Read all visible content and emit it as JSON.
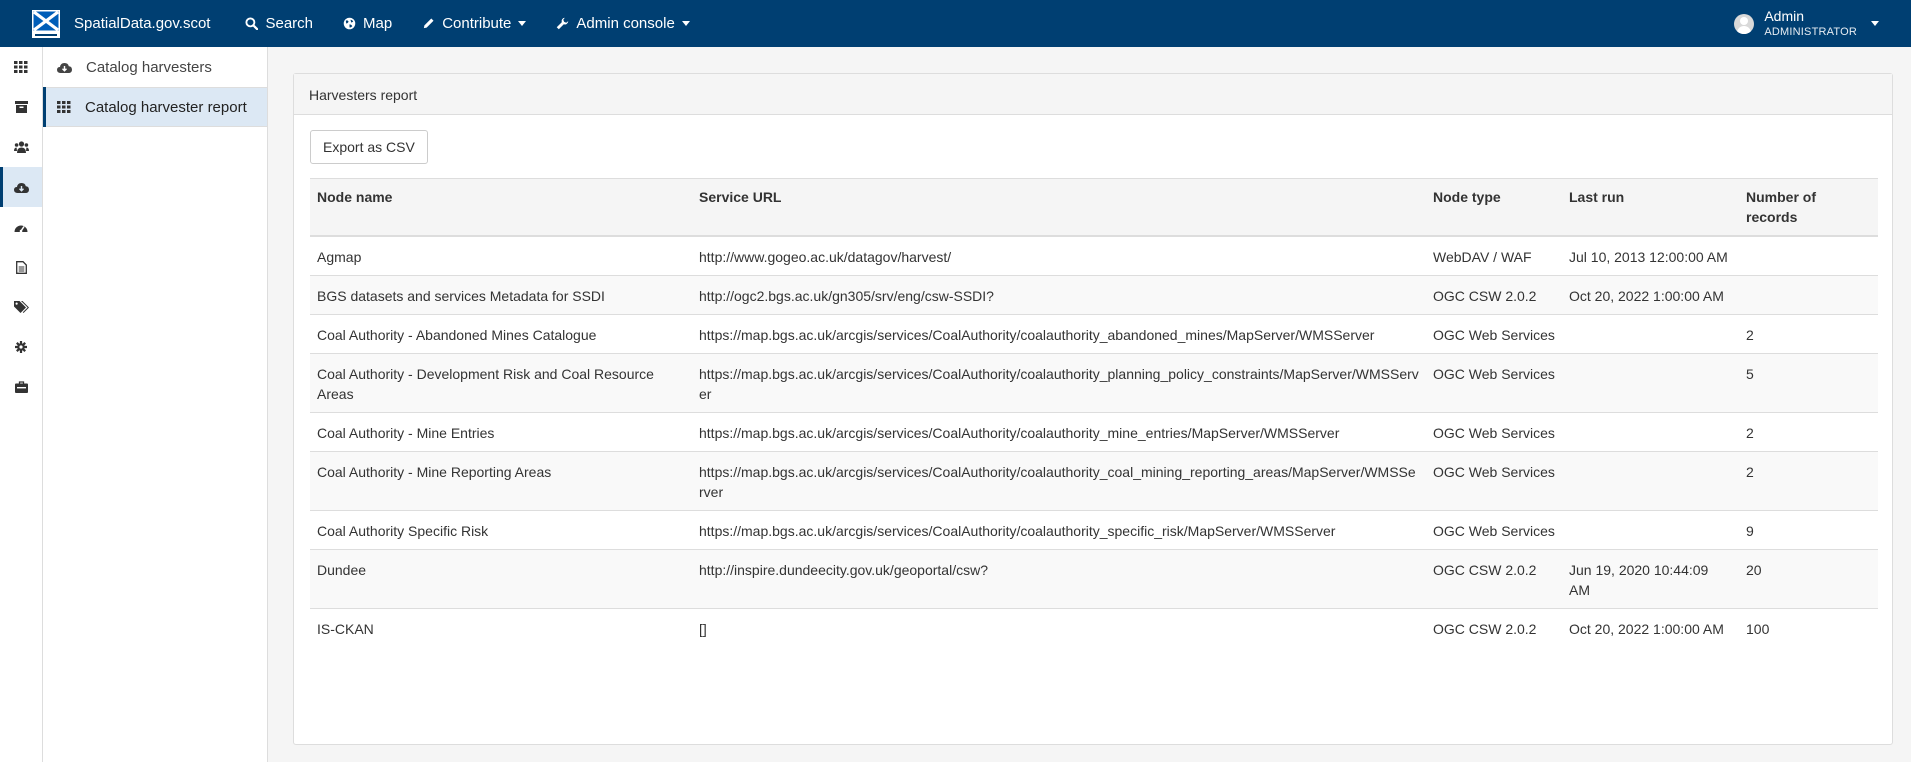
{
  "navbar": {
    "brand_name": "SpatialData.gov.scot",
    "items": [
      {
        "label": "Search",
        "icon": "search-icon"
      },
      {
        "label": "Map",
        "icon": "globe-icon"
      },
      {
        "label": "Contribute",
        "icon": "pencil-icon"
      },
      {
        "label": "Admin console",
        "icon": "wrench-icon"
      }
    ],
    "user": {
      "name": "Admin",
      "role": "ADMINISTRATOR"
    }
  },
  "rail": {
    "items": [
      "grid-icon",
      "archive-icon",
      "users-icon",
      "cloud-download-icon",
      "dashboard-icon",
      "file-icon",
      "tags-icon",
      "gear-icon",
      "toolbox-icon"
    ],
    "active_index": 3
  },
  "subnav": {
    "items": [
      {
        "label": "Catalog harvesters",
        "icon": "cloud-download-icon"
      },
      {
        "label": "Catalog harvester report",
        "icon": "grid-icon"
      }
    ],
    "active_index": 1
  },
  "panel": {
    "title": "Harvesters report",
    "export_label": "Export as CSV"
  },
  "table": {
    "headers": {
      "node_name": "Node name",
      "service_url": "Service URL",
      "node_type": "Node type",
      "last_run": "Last run",
      "num_records": "Number of records"
    },
    "rows": [
      {
        "node_name": "Agmap",
        "service_url": "http://www.gogeo.ac.uk/datagov/harvest/",
        "node_type": "WebDAV / WAF",
        "last_run": "Jul 10, 2013 12:00:00 AM",
        "num_records": ""
      },
      {
        "node_name": "BGS datasets and services Metadata for SSDI",
        "service_url": "http://ogc2.bgs.ac.uk/gn305/srv/eng/csw-SSDI?",
        "node_type": "OGC CSW 2.0.2",
        "last_run": "Oct 20, 2022 1:00:00 AM",
        "num_records": ""
      },
      {
        "node_name": "Coal Authority - Abandoned Mines Catalogue",
        "service_url": "https://map.bgs.ac.uk/arcgis/services/CoalAuthority/coalauthority_abandoned_mines/MapServer/WMSServer",
        "node_type": "OGC Web Services",
        "last_run": "",
        "num_records": "2"
      },
      {
        "node_name": "Coal Authority - Development Risk and Coal Resource Areas",
        "service_url": "https://map.bgs.ac.uk/arcgis/services/CoalAuthority/coalauthority_planning_policy_constraints/MapServer/WMSServer",
        "node_type": "OGC Web Services",
        "last_run": "",
        "num_records": "5"
      },
      {
        "node_name": "Coal Authority - Mine Entries",
        "service_url": "https://map.bgs.ac.uk/arcgis/services/CoalAuthority/coalauthority_mine_entries/MapServer/WMSServer",
        "node_type": "OGC Web Services",
        "last_run": "",
        "num_records": "2"
      },
      {
        "node_name": "Coal Authority - Mine Reporting Areas",
        "service_url": "https://map.bgs.ac.uk/arcgis/services/CoalAuthority/coalauthority_coal_mining_reporting_areas/MapServer/WMSServer",
        "node_type": "OGC Web Services",
        "last_run": "",
        "num_records": "2"
      },
      {
        "node_name": "Coal Authority Specific Risk",
        "service_url": "https://map.bgs.ac.uk/arcgis/services/CoalAuthority/coalauthority_specific_risk/MapServer/WMSServer",
        "node_type": "OGC Web Services",
        "last_run": "",
        "num_records": "9"
      },
      {
        "node_name": "Dundee",
        "service_url": "http://inspire.dundeecity.gov.uk/geoportal/csw?",
        "node_type": "OGC CSW 2.0.2",
        "last_run": "Jun 19, 2020 10:44:09 AM",
        "num_records": "20"
      },
      {
        "node_name": "IS-CKAN",
        "service_url": "[]",
        "node_type": "OGC CSW 2.0.2",
        "last_run": "Oct 20, 2022 1:00:00 AM",
        "num_records": "100"
      }
    ]
  },
  "colors": {
    "navbar_bg": "#003f72",
    "active_bg": "#dce8f4",
    "border": "#dddddd"
  }
}
